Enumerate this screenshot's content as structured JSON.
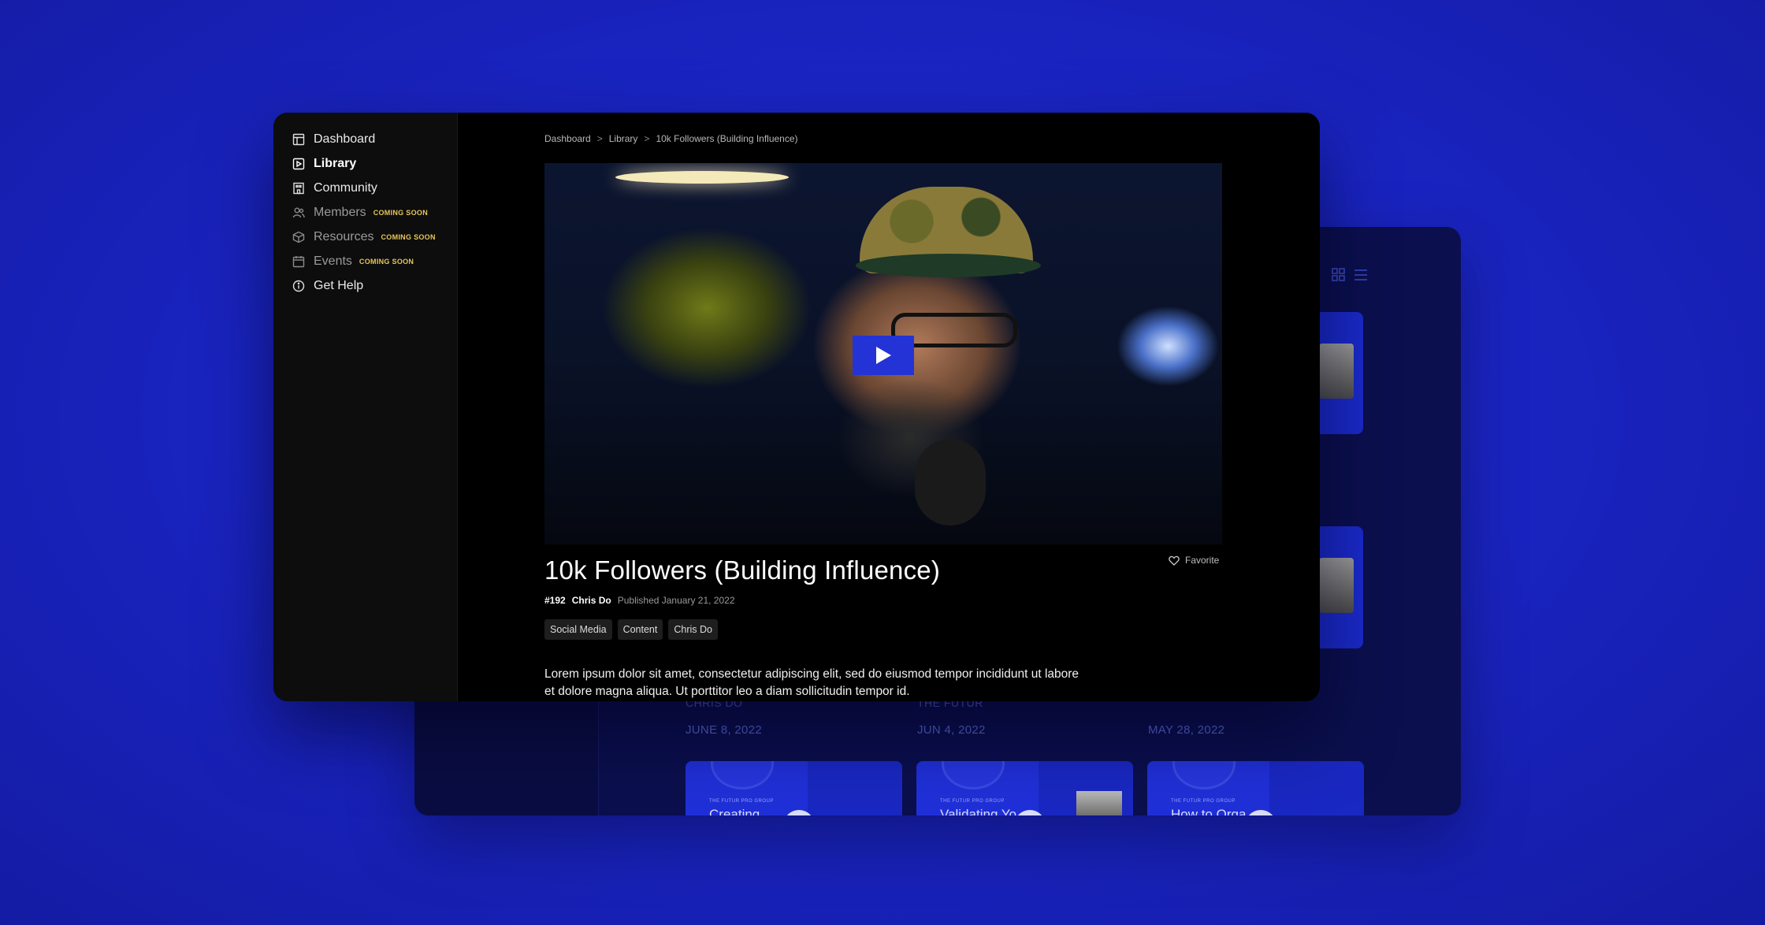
{
  "nav": {
    "items": [
      {
        "label": "Dashboard",
        "icon": "dashboard-icon",
        "badge": ""
      },
      {
        "label": "Library",
        "icon": "play-square-icon",
        "badge": ""
      },
      {
        "label": "Community",
        "icon": "building-icon",
        "badge": ""
      },
      {
        "label": "Members",
        "icon": "members-icon",
        "badge": "COMING SOON"
      },
      {
        "label": "Resources",
        "icon": "cube-icon",
        "badge": "COMING SOON"
      },
      {
        "label": "Events",
        "icon": "calendar-icon",
        "badge": "COMING SOON"
      },
      {
        "label": "Get Help",
        "icon": "info-icon",
        "badge": ""
      }
    ]
  },
  "breadcrumb": {
    "items": [
      "Dashboard",
      "Library",
      "10k Followers (Building Influence)"
    ],
    "separator": ">"
  },
  "video": {
    "title": "10k Followers (Building Influence)",
    "number": "#192",
    "author": "Chris Do",
    "published": "Published January 21, 2022",
    "favorite_label": "Favorite",
    "tags": [
      "Social Media",
      "Content",
      "Chris Do"
    ],
    "description": "Lorem ipsum dolor sit amet, consectetur adipiscing elit, sed do eiusmod tempor incididunt ut labore et dolore magna aliqua. Ut porttitor leo a diam sollicitudin tempor id."
  },
  "background_window": {
    "card_captions": [
      "CHRIS DO",
      "THE FUTUR"
    ],
    "dates": [
      "JUNE 8, 2022",
      "JUN 4, 2022",
      "MAY 28, 2022"
    ],
    "cards": [
      {
        "group": "THE FUTUR PRO GROUP",
        "title": "Creating"
      },
      {
        "group": "THE FUTUR PRO GROUP",
        "title": "Validating Yo"
      },
      {
        "group": "THE FUTUR PRO GROUP",
        "title": "How to Orga"
      }
    ]
  },
  "colors": {
    "background": "#1a25c4",
    "accent": "#2433d6",
    "badge": "#e6c65a",
    "window": "#000000",
    "sidebar": "#0d0d0d"
  }
}
